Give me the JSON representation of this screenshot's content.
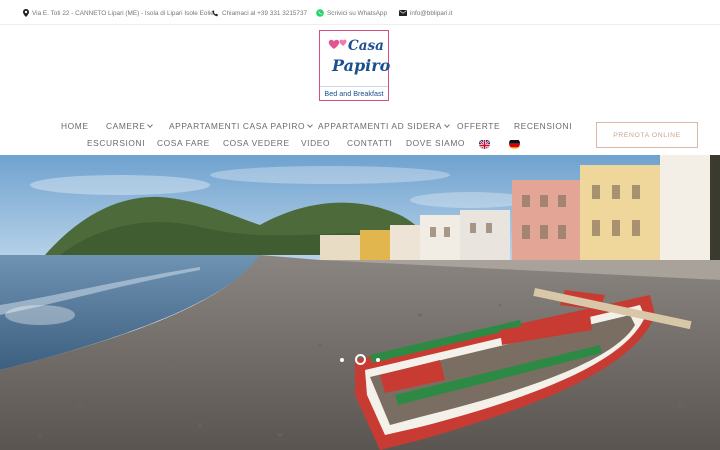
{
  "topbar": {
    "address": "Via E. Toti 22 - CANNETO Lipari (ME) - Isola di Lipari Isole Eolie",
    "phone": "Chiamaci al +39 331 3215737",
    "whatsapp": "Scrivici su WhatsApp",
    "email": "info@bblipari.it"
  },
  "logo": {
    "line1": "Casa",
    "line2": "Papiro",
    "line3": "Bed and Breakfast"
  },
  "nav": {
    "row1": [
      {
        "label": "HOME",
        "dropdown": false
      },
      {
        "label": "CAMERE",
        "dropdown": true
      },
      {
        "label": "APPARTAMENTI CASA PAPIRO",
        "dropdown": true
      },
      {
        "label": "APPARTAMENTI AD SIDERA",
        "dropdown": true
      },
      {
        "label": "OFFERTE",
        "dropdown": false
      },
      {
        "label": "RECENSIONI",
        "dropdown": false
      }
    ],
    "row2": [
      {
        "label": "ESCURSIONI"
      },
      {
        "label": "COSA FARE"
      },
      {
        "label": "COSA VEDERE"
      },
      {
        "label": "VIDEO"
      },
      {
        "label": "CONTATTI"
      },
      {
        "label": "DOVE SIAMO"
      }
    ],
    "flags": [
      "uk-flag-icon",
      "germany-flag-icon"
    ]
  },
  "book_button": "PRENOTA ONLINE",
  "slider": {
    "slides": 3,
    "active_index": 1
  },
  "colors": {
    "accent": "#c9a48c",
    "logo_blue": "#1c4f8f",
    "logo_pink": "#d24f86",
    "whatsapp": "#25d366"
  }
}
